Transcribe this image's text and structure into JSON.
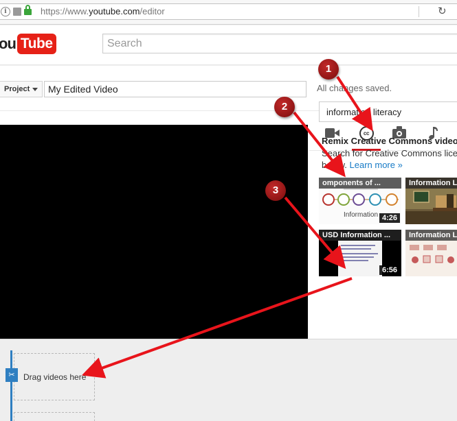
{
  "browser": {
    "url_prefix": "https://www.",
    "url_domain": "youtube.com",
    "url_path": "/editor",
    "reload_glyph": "↻"
  },
  "header": {
    "logo_you": "ou",
    "logo_tube": "Tube",
    "search_placeholder": "Search"
  },
  "editor": {
    "project_label": "Project",
    "title_value": "My Edited Video",
    "status": "All changes saved.",
    "tabs": [
      {
        "name": "video",
        "icon": "video-camera-icon"
      },
      {
        "name": "creative-commons",
        "icon": "cc-icon",
        "active": true,
        "label": "cc"
      },
      {
        "name": "photos",
        "icon": "camera-icon"
      },
      {
        "name": "audio",
        "icon": "music-note-icon"
      }
    ],
    "cc_search_value": "information literacy",
    "cc_heading": "Remix Creative Commons videos",
    "cc_desc_line1": "Search for Creative Commons licensed",
    "cc_desc_line2": "below.",
    "learn_more": "Learn more »",
    "results": [
      {
        "title": "omponents of ...",
        "caption": "Information",
        "duration": "4:26"
      },
      {
        "title": "Information Li..."
      },
      {
        "title": "USD Information ...",
        "duration": "6:56"
      },
      {
        "title": "Information Li..."
      }
    ]
  },
  "timeline": {
    "drop_label": "Drag videos here",
    "scissor_glyph": "✂"
  },
  "annotations": {
    "step1": "1",
    "step2": "2",
    "step3": "3",
    "arrow_color": "#e8141b",
    "badge_color": "#9b1414"
  }
}
